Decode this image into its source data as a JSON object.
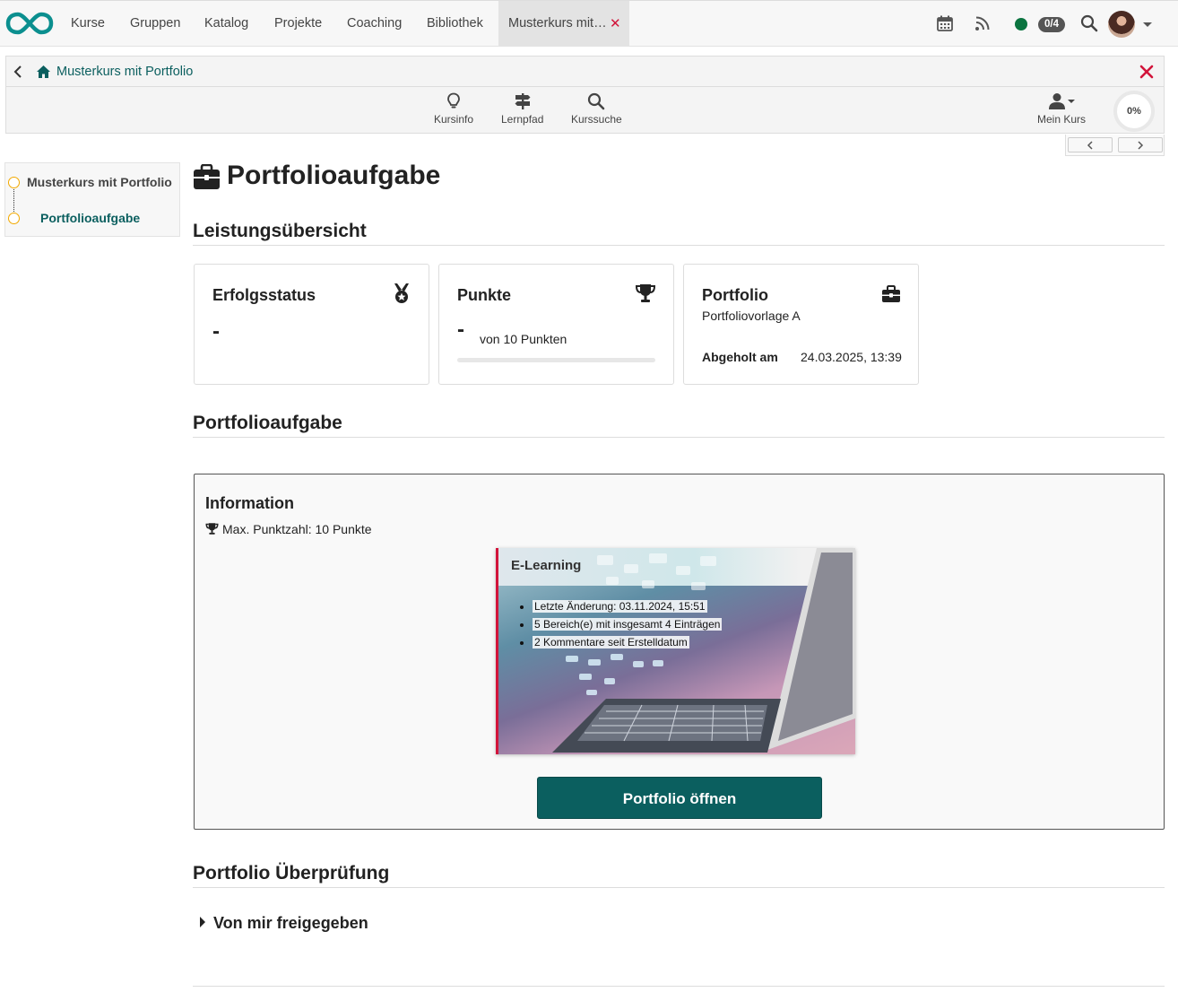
{
  "nav": {
    "items": [
      "Kurse",
      "Gruppen",
      "Katalog",
      "Projekte",
      "Coaching",
      "Bibliothek"
    ],
    "active_tab": "Musterkurs mit…",
    "active_tab_close": "✕",
    "badge": "0/4",
    "status_color": "#0b7440"
  },
  "course": {
    "title": "Musterkurs mit Portfolio",
    "tools": [
      {
        "label": "Kursinfo",
        "icon": "lightbulb-icon"
      },
      {
        "label": "Lernpfad",
        "icon": "signpost-icon"
      },
      {
        "label": "Kurssuche",
        "icon": "search-icon"
      }
    ],
    "my_course": "Mein Kurs",
    "progress": "0%"
  },
  "menu": {
    "root": "Musterkurs mit Portfolio",
    "child": "Portfolioaufgabe"
  },
  "page": {
    "title": "Portfolioaufgabe",
    "overview_heading": "Leistungsübersicht",
    "task_heading": "Portfolioaufgabe",
    "review_heading": "Portfolio Überprüfung"
  },
  "cards": {
    "status": {
      "title": "Erfolgsstatus",
      "value": "-"
    },
    "points": {
      "title": "Punkte",
      "value": "-",
      "of": "von 10 Punkten",
      "progress_fraction": 0
    },
    "portfolio": {
      "title": "Portfolio",
      "template": "Portfoliovorlage A",
      "label": "Abgeholt am",
      "date": "24.03.2025, 13:39"
    }
  },
  "info": {
    "title": "Information",
    "max_points": "Max. Punktzahl: 10 Punkte",
    "preview": {
      "title": "E-Learning",
      "bullets": [
        "Letzte Änderung: 03.11.2024, 15:51",
        "5 Bereich(e) mit insgesamt 4 Einträgen",
        "2 Kommentare seit Erstelldatum"
      ]
    },
    "button": "Portfolio öffnen"
  },
  "review": {
    "toggle": "Von mir freigegeben"
  },
  "colors": {
    "brand": "#0b5f5f",
    "danger": "#d2143a",
    "accent": "#f2a900"
  }
}
